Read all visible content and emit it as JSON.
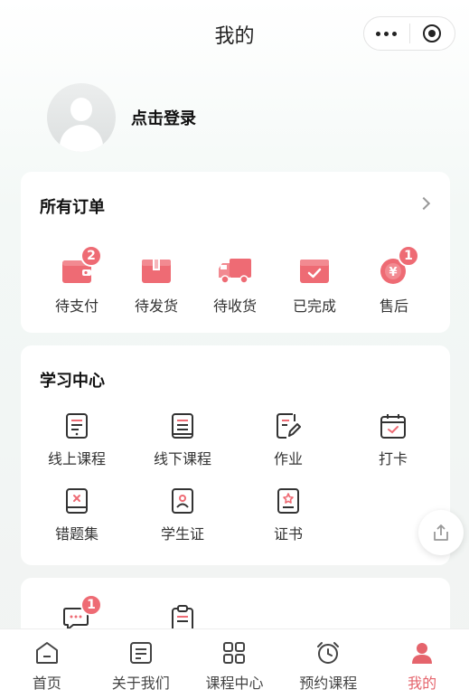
{
  "header": {
    "title": "我的"
  },
  "profile": {
    "login_label": "点击登录"
  },
  "orders": {
    "title": "所有订单",
    "items": [
      {
        "label": "待支付",
        "icon": "wallet-icon",
        "badge": "2"
      },
      {
        "label": "待发货",
        "icon": "package-box-icon",
        "badge": ""
      },
      {
        "label": "待收货",
        "icon": "truck-icon",
        "badge": ""
      },
      {
        "label": "已完成",
        "icon": "completed-box-icon",
        "badge": ""
      },
      {
        "label": "售后",
        "icon": "refund-yuan-icon",
        "badge": "1"
      }
    ]
  },
  "study": {
    "title": "学习中心",
    "items": [
      {
        "label": "线上课程",
        "icon": "online-course-icon"
      },
      {
        "label": "线下课程",
        "icon": "offline-course-icon"
      },
      {
        "label": "作业",
        "icon": "homework-icon"
      },
      {
        "label": "打卡",
        "icon": "check-in-calendar-icon"
      },
      {
        "label": "错题集",
        "icon": "wrong-questions-book-icon"
      },
      {
        "label": "学生证",
        "icon": "student-card-icon"
      },
      {
        "label": "证书",
        "icon": "certificate-icon"
      }
    ]
  },
  "more": {
    "items": [
      {
        "icon": "message-icon",
        "badge": "1"
      },
      {
        "icon": "clipboard-icon",
        "badge": ""
      }
    ]
  },
  "tabbar": {
    "items": [
      {
        "label": "首页",
        "icon": "home-icon",
        "active": false
      },
      {
        "label": "关于我们",
        "icon": "about-doc-icon",
        "active": false
      },
      {
        "label": "课程中心",
        "icon": "grid-icon",
        "active": false
      },
      {
        "label": "预约课程",
        "icon": "alarm-clock-icon",
        "active": false
      },
      {
        "label": "我的",
        "icon": "user-icon",
        "active": true
      }
    ]
  },
  "colors": {
    "accent": "#ee6b74",
    "active_tab": "#e5646c"
  }
}
